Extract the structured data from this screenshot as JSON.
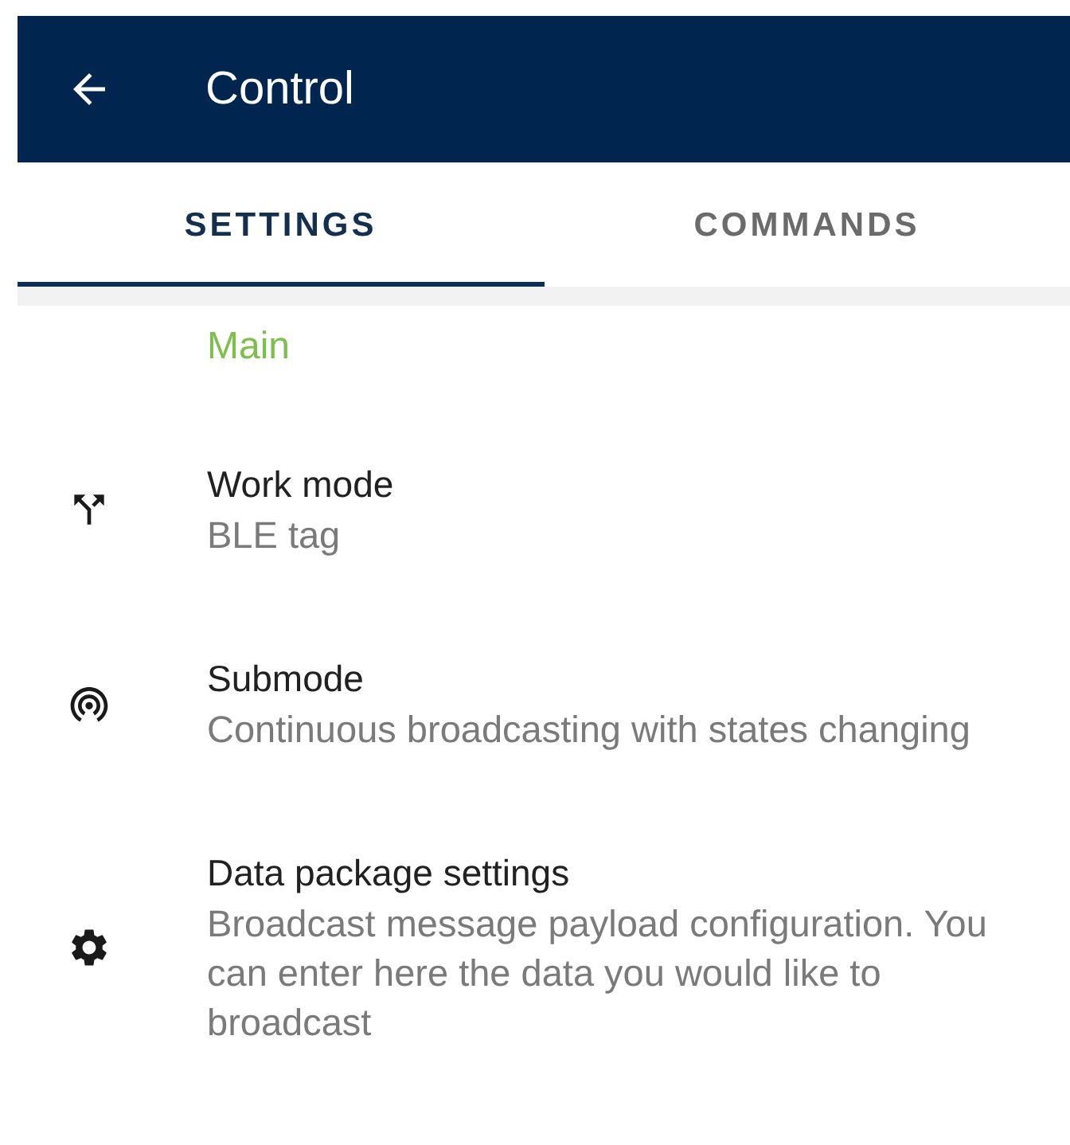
{
  "app_bar": {
    "title": "Control"
  },
  "tabs": [
    {
      "label": "SETTINGS",
      "selected": true
    },
    {
      "label": "COMMANDS",
      "selected": false
    }
  ],
  "section": {
    "title": "Main"
  },
  "items": [
    {
      "kind": "split",
      "title": "Work mode",
      "subtitle": "BLE tag"
    },
    {
      "kind": "broadcast",
      "title": "Submode",
      "subtitle": "Continuous broadcasting with states changing"
    },
    {
      "kind": "settings",
      "title": "Data package settings",
      "subtitle": "Broadcast message payload configuration. You can enter here the data you would like to broadcast"
    }
  ]
}
